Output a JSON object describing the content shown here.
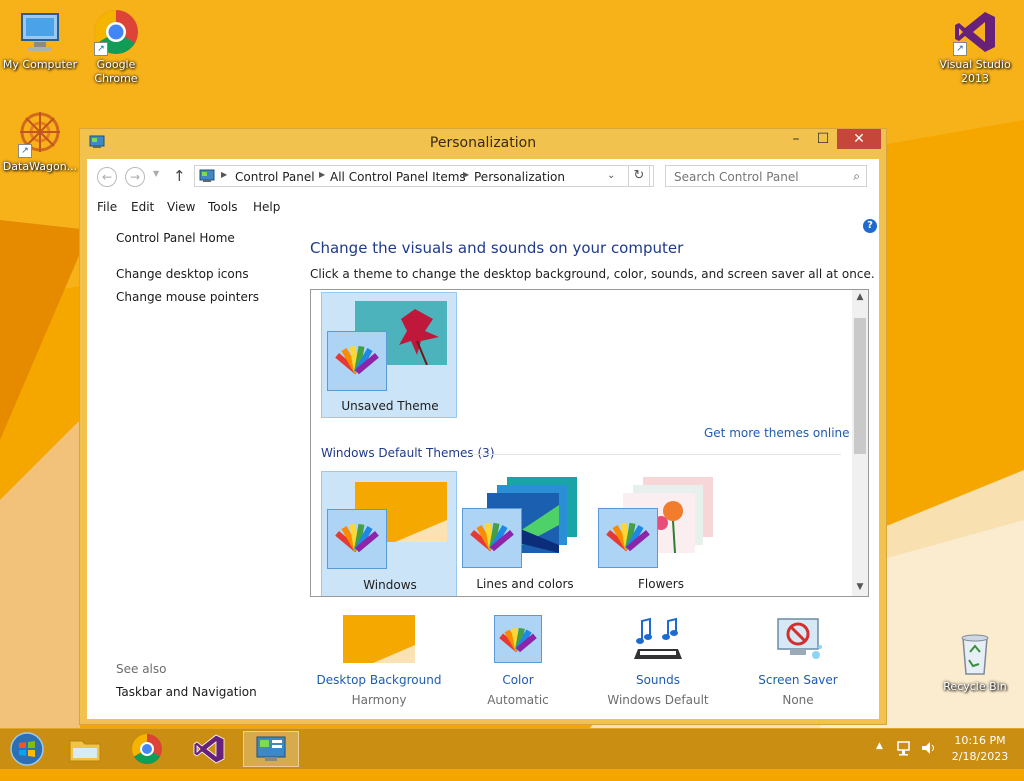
{
  "colors": {
    "desktop": "#f4a500",
    "window_frame": "#f2c24f",
    "close_button": "#c7463b",
    "link_blue": "#1e5bb5",
    "heading_blue": "#1e3a8a",
    "selection": "#cce4f7",
    "taskbar": "#c98e12"
  },
  "desktop": {
    "icons": [
      {
        "label": "My Computer",
        "icon": "computer-icon"
      },
      {
        "label": "Google Chrome",
        "icon": "chrome-icon"
      },
      {
        "label": "DataWagon...",
        "icon": "datawagon-icon"
      },
      {
        "label": "Visual Studio 2013",
        "icon": "visual-studio-icon"
      },
      {
        "label": "Recycle Bin",
        "icon": "recycle-bin-icon"
      }
    ]
  },
  "window": {
    "title": "Personalization",
    "controls": {
      "minimize": "–",
      "maximize": "☐",
      "close": "✕"
    },
    "breadcrumb": [
      "Control Panel",
      "All Control Panel Items",
      "Personalization"
    ],
    "search_placeholder": "Search Control Panel",
    "menu": [
      "File",
      "Edit",
      "View",
      "Tools",
      "Help"
    ]
  },
  "sidebar": {
    "home": "Control Panel Home",
    "links": [
      "Change desktop icons",
      "Change mouse pointers"
    ],
    "see_also_heading": "See also",
    "see_also_links": [
      "Taskbar and Navigation"
    ]
  },
  "main": {
    "title": "Change the visuals and sounds on your computer",
    "description": "Click a theme to change the desktop background, color, sounds, and screen saver all at once.",
    "my_themes": [
      {
        "label": "Unsaved Theme",
        "selected": true
      }
    ],
    "get_more_link": "Get more themes online",
    "default_group_label": "Windows Default Themes (3)",
    "default_themes": [
      {
        "label": "Windows",
        "selected": true
      },
      {
        "label": "Lines and colors",
        "selected": false
      },
      {
        "label": "Flowers",
        "selected": false
      }
    ]
  },
  "bottom": [
    {
      "title": "Desktop Background",
      "value": "Harmony",
      "icon": "desktop-background-icon"
    },
    {
      "title": "Color",
      "value": "Automatic",
      "icon": "color-icon"
    },
    {
      "title": "Sounds",
      "value": "Windows Default",
      "icon": "sounds-icon"
    },
    {
      "title": "Screen Saver",
      "value": "None",
      "icon": "screen-saver-icon"
    }
  ],
  "taskbar": {
    "time": "10:16 PM",
    "date": "2/18/2023"
  }
}
